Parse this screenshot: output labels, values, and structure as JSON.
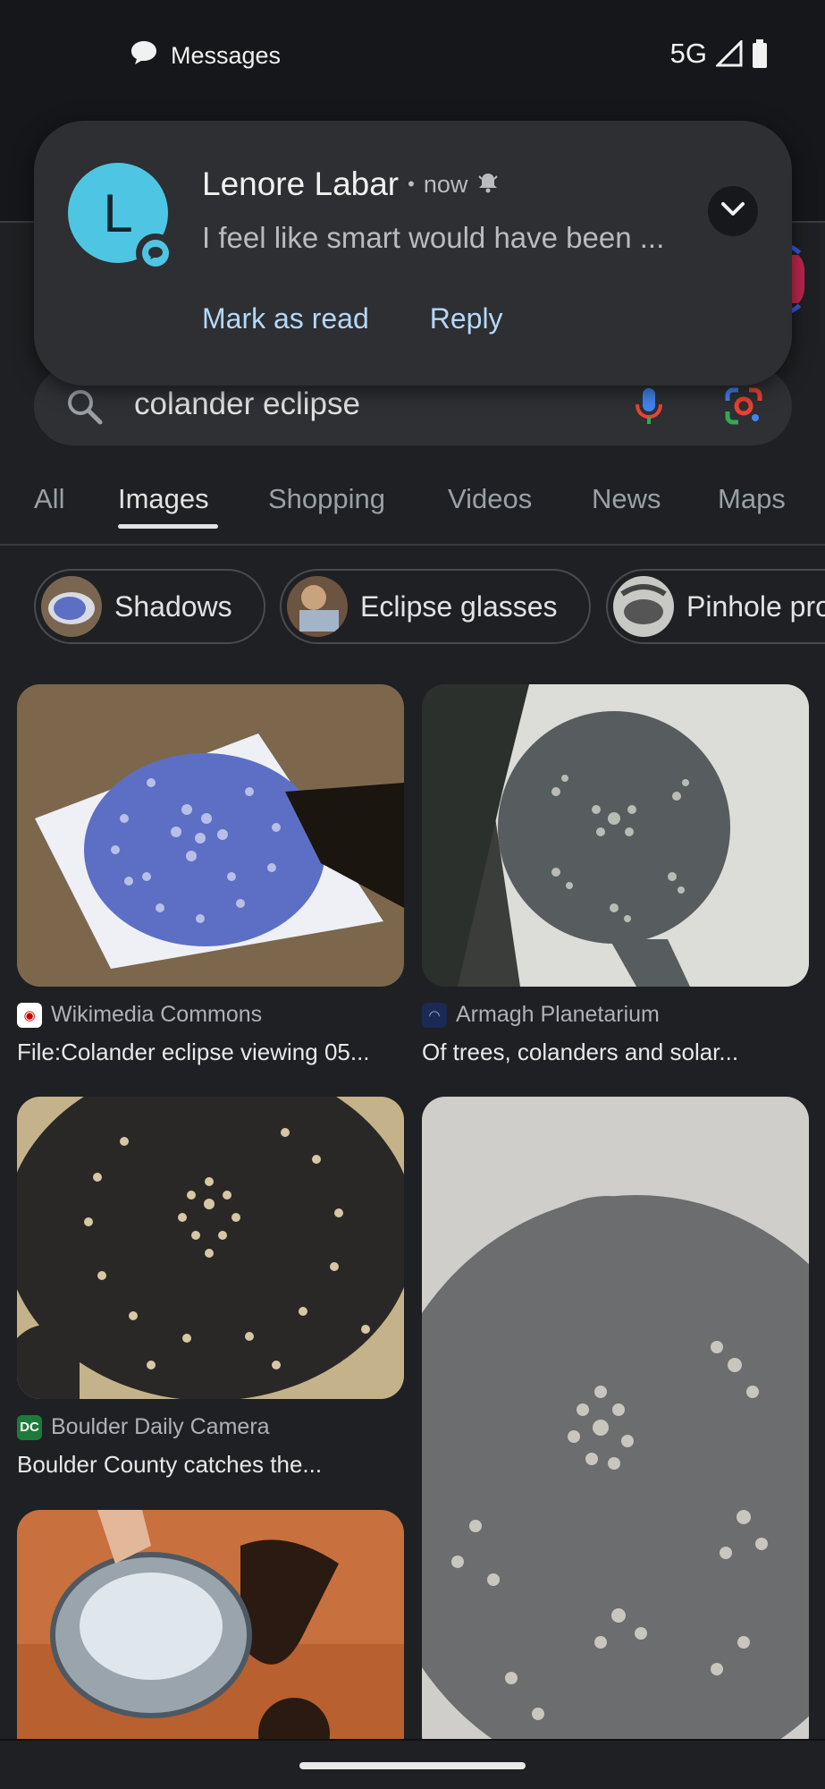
{
  "status_bar": {
    "notification_app": "Messages",
    "network": "5G"
  },
  "notification": {
    "avatar_letter": "L",
    "sender": "Lenore Labar",
    "separator": "•",
    "time": "now",
    "message": "I feel like smart would have been ...",
    "actions": [
      "Mark as read",
      "Reply"
    ]
  },
  "search": {
    "query": "colander eclipse"
  },
  "tabs": [
    "All",
    "Images",
    "Shopping",
    "Videos",
    "News",
    "Maps"
  ],
  "active_tab": "Images",
  "chips": [
    "Shadows",
    "Eclipse glasses",
    "Pinhole pro"
  ],
  "results": [
    {
      "source": "Wikimedia Commons",
      "title": "File:Colander eclipse viewing 05..."
    },
    {
      "source": "Armagh Planetarium",
      "title": "Of trees, colanders and solar..."
    },
    {
      "source": "Boulder Daily Camera",
      "source_badge": "DC",
      "title": "Boulder County catches the..."
    }
  ],
  "colors": {
    "background": "#1f2023",
    "notification_card": "#2d2f33",
    "accent_link": "#b5d8f6",
    "avatar": "#4ec6e3"
  }
}
